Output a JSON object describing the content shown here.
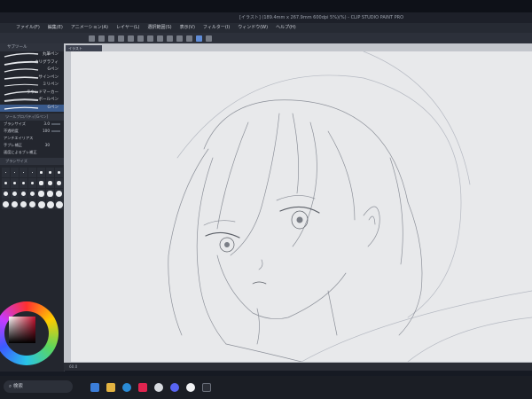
{
  "window": {
    "title": "[イラスト] (189.4mm x 267.9mm 600dpi 5%)(%) - CLIP STUDIO PAINT PRO"
  },
  "menu": [
    "ファイル(F)",
    "編集(E)",
    "アニメーション(A)",
    "レイヤー(L)",
    "選択範囲(S)",
    "表示(V)",
    "フィルター(I)",
    "ウィンドウ(W)",
    "ヘルプ(H)"
  ],
  "brushes": {
    "header": "サブツール",
    "items": [
      "丸ペン",
      "カブラペン",
      "Gペン",
      "サインペン",
      "ミリペン",
      "リアルGペン",
      "デコ",
      "スプーン",
      "たち込み",
      "ペン",
      "つけペン",
      "サインペン",
      "ミリペン",
      "ラウンドマーカー",
      "ペン"
    ],
    "labels": [
      "丸筆ペン",
      "カリグラフィ",
      "Gペン",
      "サインペン",
      "ミリペン",
      "リアルGペン",
      "ラウンドマーカー",
      "ボールペン",
      "ソフトペン"
    ]
  },
  "tool_property": {
    "header": "ツールプロパティ[Gペン]",
    "rows": [
      {
        "label": "ブラシサイズ",
        "value": "3.0"
      },
      {
        "label": "不透明度",
        "value": "100"
      },
      {
        "label": "アンチエイリアス",
        "value": ""
      },
      {
        "label": "手ブレ補正",
        "value": "30"
      },
      {
        "label": "速度によるブレ補正",
        "value": ""
      }
    ]
  },
  "brush_size": {
    "header": "ブラシサイズ",
    "sizes": [
      "0.7",
      "1",
      "1.5",
      "2",
      "2.5",
      "3",
      "4",
      "5",
      "6",
      "7",
      "8",
      "10",
      "12",
      "15",
      "17",
      "20",
      "25",
      "30",
      "40",
      "50",
      "60",
      "70",
      "80",
      "100",
      "120",
      "150",
      "170",
      "200"
    ]
  },
  "doc_tab": "イラスト",
  "status": "60.0",
  "taskbar": {
    "search_placeholder": "検索"
  },
  "colors": {
    "accent": "#6ea4ff",
    "main_color": "#c8102e"
  }
}
